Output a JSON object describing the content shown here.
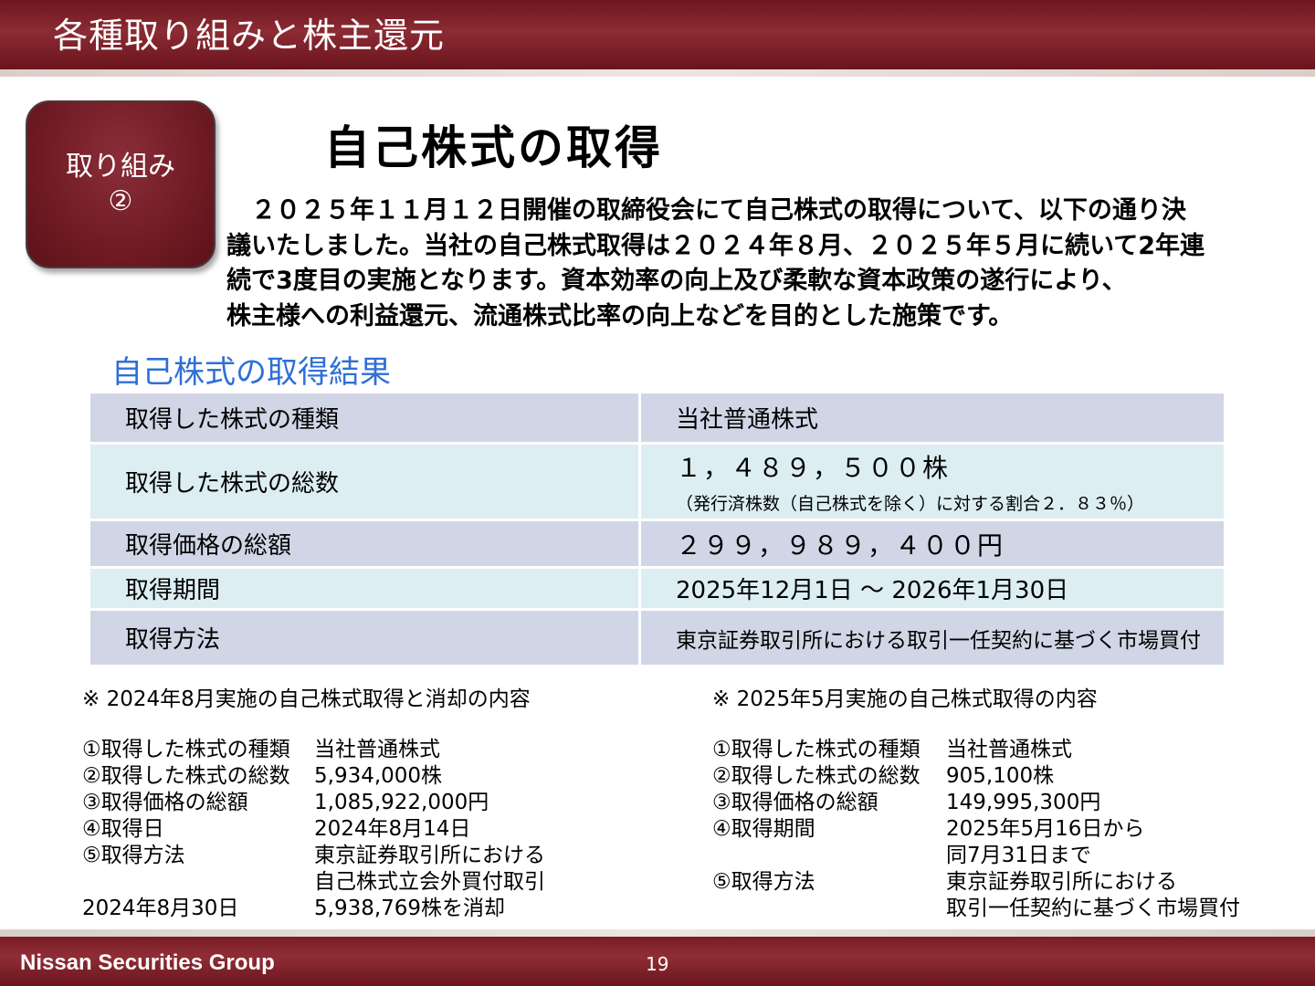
{
  "header": {
    "title": "各種取り組みと株主還元"
  },
  "badge": {
    "line1": "取り組み",
    "line2": "②"
  },
  "main": {
    "title": "自己株式の取得",
    "intro_lines": [
      "　２０２５年１１月１２日開催の取締役会にて自己株式の取得について、以下の通り決",
      "議いたしました。当社の自己株式取得は２０２４年８月、２０２５年５月に続いて2年連",
      "続で3度目の実施となります。資本効率の向上及び柔軟な資本政策の遂行により、",
      "株主様への利益還元、流通株式比率の向上などを目的とした施策です。"
    ]
  },
  "results": {
    "heading": "自己株式の取得結果",
    "rows": [
      {
        "label": "取得した株式の種類",
        "value": "当社普通株式"
      },
      {
        "label": "取得した株式の総数",
        "value": "１，４８９，５００株",
        "sub": "（発行済株数（自己株式を除く）に対する割合２．８３％）"
      },
      {
        "label": "取得価格の総額",
        "value": "２９９，９８９，４００円"
      },
      {
        "label": "取得期間",
        "value": "2025年12月1日 ～ 2026年1月30日"
      },
      {
        "label": "取得方法",
        "value": "東京証券取引所における取引一任契約に基づく市場買付"
      }
    ]
  },
  "note_2024": {
    "title": "※ 2024年8月実施の自己株式取得と消却の内容",
    "items": [
      {
        "key": "①取得した株式の種類",
        "value": "当社普通株式"
      },
      {
        "key": "②取得した株式の総数",
        "value": "5,934,000株"
      },
      {
        "key": "③取得価格の総額",
        "value": "1,085,922,000円"
      },
      {
        "key": "④取得日",
        "value": "2024年8月14日"
      },
      {
        "key": "⑤取得方法",
        "value": "東京証券取引所における"
      },
      {
        "key": "",
        "value": "自己株式立会外買付取引"
      },
      {
        "key": "2024年8月30日",
        "value": "5,938,769株を消却"
      }
    ]
  },
  "note_2025": {
    "title": "※ 2025年5月実施の自己株式取得の内容",
    "items": [
      {
        "key": "①取得した株式の種類",
        "value": "当社普通株式"
      },
      {
        "key": "②取得した株式の総数",
        "value": "905,100株"
      },
      {
        "key": "③取得価格の総額",
        "value": "149,995,300円"
      },
      {
        "key": "④取得期間",
        "value": "2025年5月16日から"
      },
      {
        "key": "",
        "value": "同7月31日まで"
      },
      {
        "key": "⑤取得方法",
        "value": "東京証券取引所における"
      },
      {
        "key": "",
        "value": "取引一任契約に基づく市場買付"
      }
    ]
  },
  "footer": {
    "company": "Nissan Securities Group",
    "page": "19"
  },
  "colors": {
    "header_bg": "#7a1c24",
    "heading_blue": "#2f6fd6",
    "row_a": "#d1d6e6",
    "row_b": "#dceef2"
  }
}
